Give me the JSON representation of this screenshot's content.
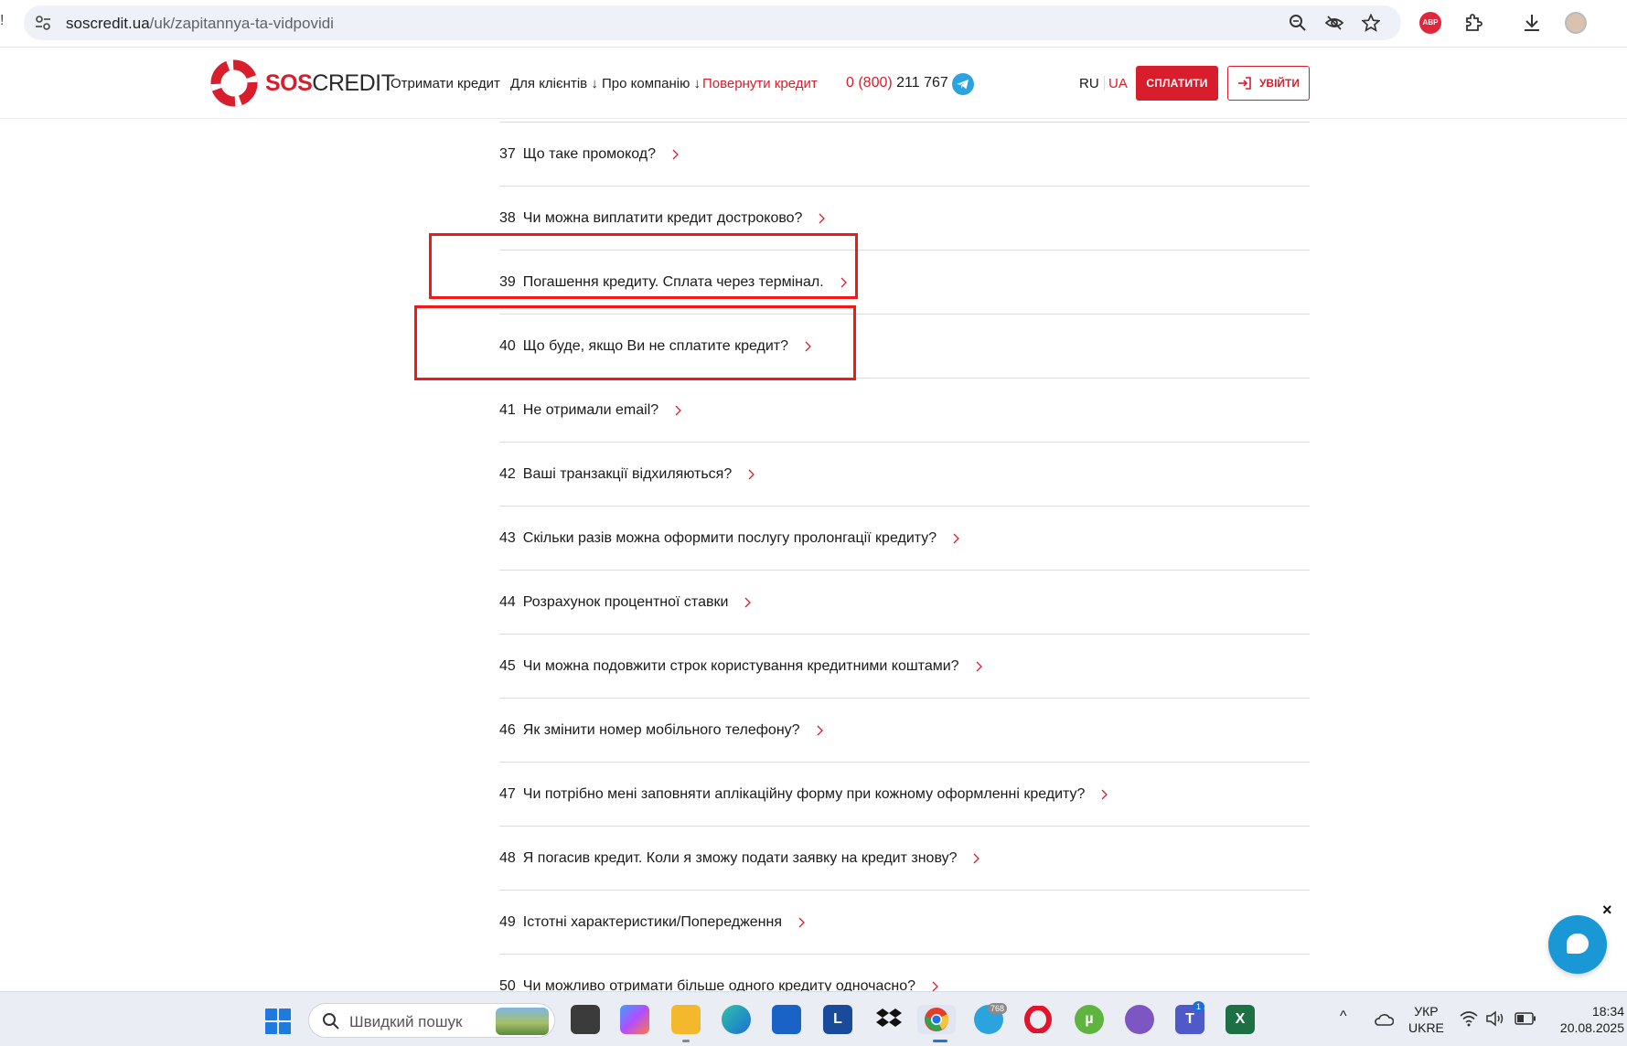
{
  "browser": {
    "url_host": "soscredit.ua",
    "url_path": "/uk/zapitannya-ta-vidpovidi",
    "left_edge_glyph": "!"
  },
  "header": {
    "logo_sos": "SOS",
    "logo_credit": "CREDIT",
    "nav": {
      "get_credit": "Отримати кредит",
      "for_clients": "Для клієнтів",
      "about": "Про компанію",
      "return_credit": "Повернути кредит",
      "dropdown_glyph": "↓"
    },
    "phone_prefix": "0 (800)",
    "phone_number": "211 767",
    "lang_ru": "RU",
    "lang_ua": "UA",
    "pay_label": "СПЛАТИТИ",
    "login_label": "УВІЙТИ"
  },
  "faq": {
    "items": [
      {
        "num": "37",
        "text": "Що таке промокод?"
      },
      {
        "num": "38",
        "text": "Чи можна виплатити кредит достроково?"
      },
      {
        "num": "39",
        "text": "Погашення кредиту. Сплата через термінал."
      },
      {
        "num": "40",
        "text": "Що буде, якщо Ви не сплатите кредит?"
      },
      {
        "num": "41",
        "text": "Не отримали email?"
      },
      {
        "num": "42",
        "text": "Ваші транзакції відхиляються?"
      },
      {
        "num": "43",
        "text": "Скільки разів можна оформити послугу пролонгації кредиту?"
      },
      {
        "num": "44",
        "text": "Розрахунок процентної ставки"
      },
      {
        "num": "45",
        "text": "Чи можна подовжити строк користування кредитними коштами?"
      },
      {
        "num": "46",
        "text": "Як змінити номер мобільного телефону?"
      },
      {
        "num": "47",
        "text": "Чи потрібно мені заповняти аплікаційну форму при кожному оформленні кредиту?"
      },
      {
        "num": "48",
        "text": "Я погасив кредит. Коли я зможу подати заявку на кредит знову?"
      },
      {
        "num": "49",
        "text": "Істотні характеристики/Попередження"
      },
      {
        "num": "50",
        "text": "Чи можливо отримати більше одного кредиту одночасно?"
      }
    ]
  },
  "chat": {
    "close_glyph": "×"
  },
  "taskbar": {
    "search_placeholder": "Швидкий пошук",
    "telegram_badge": "768",
    "teams_badge": "1",
    "lang_line1": "УКР",
    "lang_line2": "UKRE",
    "time": "18:34",
    "date": "20.08.2025",
    "tray_chevron": "^"
  },
  "colors": {
    "brand_red": "#d81e2c",
    "annotation_red": "#f21818",
    "chat_blue": "#1a98d5"
  }
}
